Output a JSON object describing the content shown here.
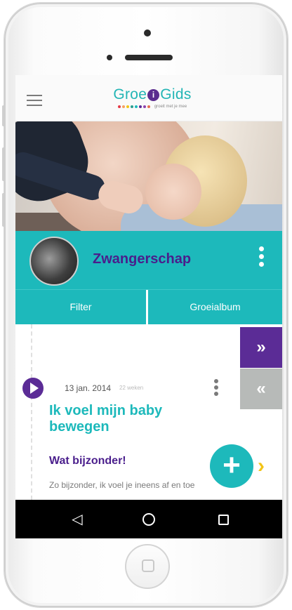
{
  "app": {
    "logo_text_left": "Groe",
    "logo_text_i": "i",
    "logo_text_right": "Gids",
    "logo_tagline": "groeit met je mee",
    "logo_dot_colors": [
      "#e63946",
      "#f4a261",
      "#f2c417",
      "#2a9d8f",
      "#1db9bb",
      "#5b2c96",
      "#8e44ad",
      "#e76f51"
    ]
  },
  "topbar": {
    "menu_icon": "hamburger-menu-icon"
  },
  "profile": {
    "title": "Zwangerschap",
    "avatar": "ultrasound-avatar",
    "menu_icon": "more-vertical-icon"
  },
  "tabs": [
    {
      "label": "Filter"
    },
    {
      "label": "Groeialbum"
    }
  ],
  "side_nav": {
    "next_label": "»",
    "prev_label": "«"
  },
  "entry": {
    "date": "13 jan. 2014",
    "weeks": "22 weken",
    "title": "Ik voel mijn baby bewegen",
    "subtitle": "Wat bijzonder!",
    "body": "Zo bijzonder, ik voel je ineens af en toe",
    "type_icon": "play-icon",
    "menu_icon": "more-vertical-icon"
  },
  "fab": {
    "label": "+"
  },
  "next_chevron": "›",
  "android_nav": {
    "back_label": "◁",
    "home_icon": "home-circle-icon",
    "recents_icon": "recents-square-icon"
  },
  "colors": {
    "teal": "#1db9bb",
    "purple": "#5b2c96",
    "title_purple": "#4a1e8c",
    "grey_button": "#b7bab8",
    "yellow": "#f2c417"
  }
}
